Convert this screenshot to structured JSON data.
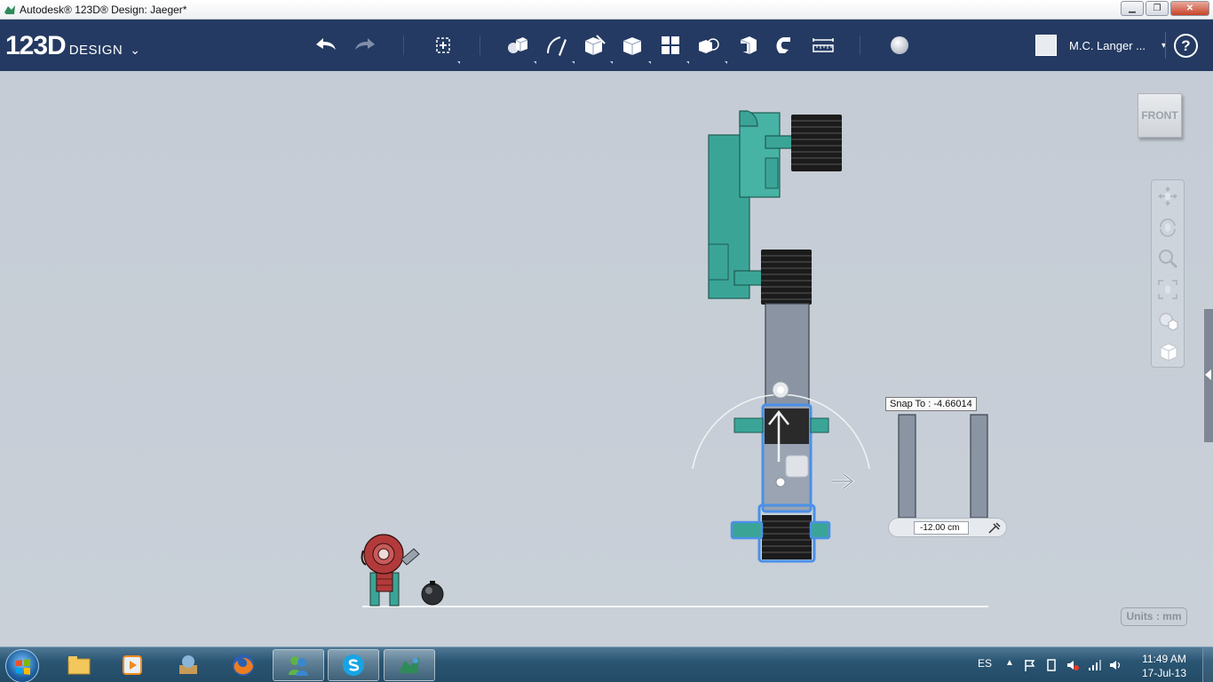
{
  "window": {
    "title": "Autodesk® 123D® Design: Jaeger*",
    "minimize_glyph": "▁",
    "maximize_glyph": "❐",
    "close_glyph": "✕"
  },
  "app": {
    "logo_main": "123D",
    "logo_sub": "DESIGN",
    "logo_chevron": "⌄"
  },
  "toolbar": {
    "tools": [
      {
        "icon": "undo-icon"
      },
      {
        "icon": "redo-icon"
      },
      {
        "icon": "transform-icon"
      },
      {
        "icon": "primitives-icon"
      },
      {
        "icon": "sketch-icon"
      },
      {
        "icon": "construct-icon"
      },
      {
        "icon": "modify-icon"
      },
      {
        "icon": "pattern-icon"
      },
      {
        "icon": "grouping-icon"
      },
      {
        "icon": "combine-icon"
      },
      {
        "icon": "snap-icon"
      },
      {
        "icon": "measure-icon"
      },
      {
        "icon": "material-icon"
      }
    ],
    "user_name": "M.C. Langer ...",
    "user_caret": "▾",
    "help_label": "?"
  },
  "viewport": {
    "viewcube_label": "FRONT",
    "nav_tools": [
      "pan-icon",
      "orbit-icon",
      "zoom-icon",
      "fit-icon",
      "view-mode-icon",
      "material-view-icon"
    ],
    "snap_tooltip": "Snap To : -4.66014",
    "dimension_value": "-12.00 cm",
    "units_label": "Units : mm"
  },
  "colors": {
    "toolbar_bg": "#243a62",
    "viewport_bg": "#c7ced6",
    "teal_part": "#3aa597",
    "black_part": "#1b1b1b",
    "gray_part": "#8a94a3",
    "red_part": "#b33a3a",
    "selection_blue": "#4a90e8"
  },
  "taskbar": {
    "apps": [
      "explorer-icon",
      "media-player-icon",
      "tools-icon",
      "firefox-icon",
      "messenger-icon",
      "skype-icon",
      "123d-design-icon"
    ],
    "language": "ES",
    "time": "11:49 AM",
    "date": "17-Jul-13"
  }
}
